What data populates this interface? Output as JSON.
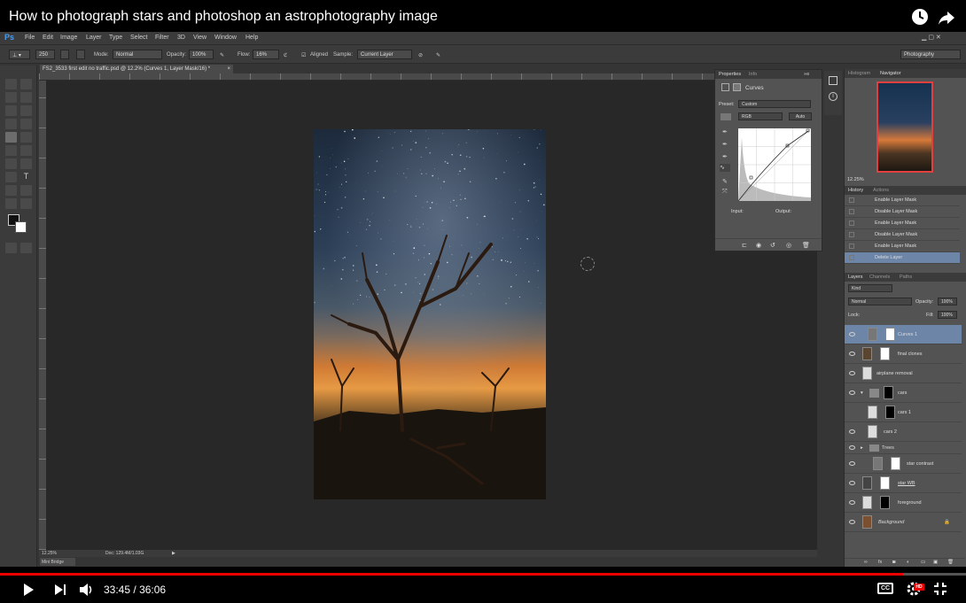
{
  "video": {
    "title": "How to photograph stars and photoshop an astrophotography image",
    "time_current": "33:45",
    "time_separator": "/",
    "time_total": "36:06",
    "progress_fraction": 0.935,
    "hd_badge": "HD",
    "cc_label": "CC"
  },
  "ps": {
    "logo": "Ps",
    "menu": [
      "File",
      "Edit",
      "Image",
      "Layer",
      "Type",
      "Select",
      "Filter",
      "3D",
      "View",
      "Window",
      "Help"
    ],
    "options": {
      "brush_size": "250",
      "mode_label": "Mode:",
      "mode_value": "Normal",
      "opacity_label": "Opacity:",
      "opacity_value": "100%",
      "flow_label": "Flow:",
      "flow_value": "16%",
      "aligned_label": "Aligned",
      "sample_label": "Sample:",
      "sample_value": "Current Layer",
      "workspace": "Photography"
    },
    "doc_tab": "FS2_3533 first edit no traffic.psd @ 12.2% (Curves 1, Layer Mask/16) *",
    "status_zoom": "12.25%",
    "status_doc": "Doc: 129.4M/1.03G",
    "mini_bridge": "Mini Bridge",
    "properties": {
      "tab_properties": "Properties",
      "tab_info": "Info",
      "title": "Curves",
      "preset_label": "Preset:",
      "preset_value": "Custom",
      "channel": "RGB",
      "auto": "Auto",
      "input_label": "Input:",
      "output_label": "Output:"
    },
    "navigator": {
      "tab_histogram": "Histogram",
      "tab_navigator": "Navigator",
      "zoom": "12.25%"
    },
    "history": {
      "tab_history": "History",
      "tab_actions": "Actions",
      "items": [
        "Enable Layer Mask",
        "Disable Layer Mask",
        "Enable Layer Mask",
        "Disable Layer Mask",
        "Enable Layer Mask",
        "Delete Layer"
      ]
    },
    "layers": {
      "tab_layers": "Layers",
      "tab_channels": "Channels",
      "tab_paths": "Paths",
      "kind": "Kind",
      "blend": "Normal",
      "opacity_label": "Opacity:",
      "opacity_value": "100%",
      "lock_label": "Lock:",
      "fill_label": "Fill:",
      "fill_value": "100%",
      "items": [
        "Curves 1",
        "final clones",
        "airplane removal",
        "cars",
        "cars 1",
        "cars 2",
        "Trees",
        "star contrast",
        "star WB",
        "foreground",
        "Background"
      ]
    }
  },
  "colors": {
    "accent": "#e00000",
    "ps_blue": "#4a7fbf",
    "panel": "#535353"
  }
}
